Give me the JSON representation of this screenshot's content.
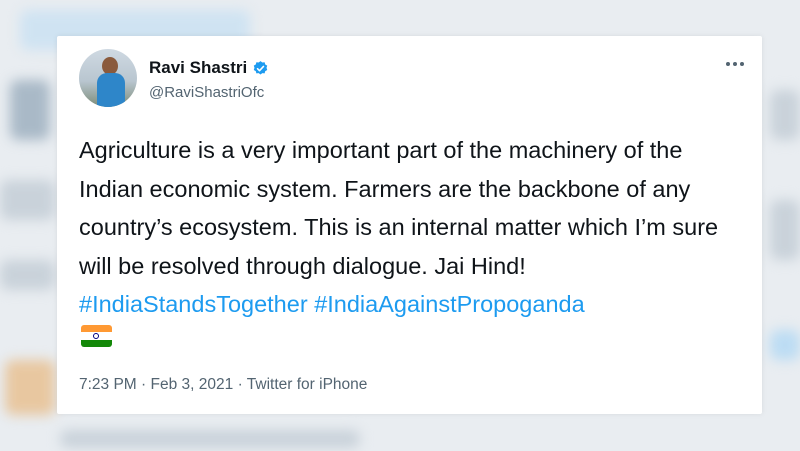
{
  "author": {
    "display_name": "Ravi Shastri",
    "handle": "@RaviShastriOfc",
    "verified": true
  },
  "tweet": {
    "text_plain": "Agriculture is a very important part of the machinery of the Indian economic system. Farmers are the backbone of any country’s ecosystem. This is an internal matter which I’m sure will be resolved through dialogue. Jai Hind!",
    "hashtags": [
      "#IndiaStandsTogether",
      "#IndiaAgainstPropoganda"
    ],
    "emoji": "india-flag"
  },
  "meta": {
    "time": "7:23 PM",
    "separator": "·",
    "date": "Feb 3, 2021",
    "source": "Twitter for iPhone"
  },
  "colors": {
    "text": "#0f1419",
    "secondary": "#536471",
    "accent": "#1d9bf0"
  },
  "icons": {
    "verified": "verified-badge-icon",
    "more": "more-options-icon"
  }
}
